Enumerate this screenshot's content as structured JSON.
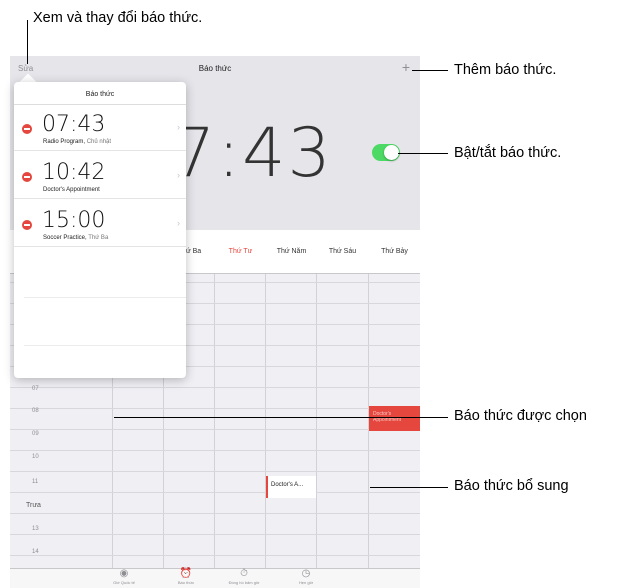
{
  "callouts": {
    "view_edit": "Xem và thay đổi báo thức.",
    "add": "Thêm báo thức.",
    "toggle": "Bật/tắt báo thức.",
    "selected": "Báo thức được chọn",
    "additional": "Báo thức bổ sung"
  },
  "navbar": {
    "edit_label": "Sửa",
    "title": "Báo thức",
    "add_symbol": "+"
  },
  "main": {
    "big_time": "7:43",
    "toggle_on": true,
    "accent_color": "#e5463d",
    "toggle_color": "#4cd964"
  },
  "week": {
    "days": [
      "Thứ Ba",
      "Thứ Tư",
      "Thứ Năm",
      "Thứ Sáu",
      "Thứ Bảy"
    ],
    "today_index": 1,
    "hours": [
      "07",
      "08",
      "09",
      "10",
      "11",
      "Trưa",
      "13",
      "14"
    ]
  },
  "popover": {
    "title": "Báo thức",
    "alarms": [
      {
        "time": "07:43",
        "label": "Radio Program",
        "repeat": "Chủ nhật"
      },
      {
        "time": "10:42",
        "label": "Doctor's Appointment",
        "repeat": ""
      },
      {
        "time": "15:00",
        "label": "Soccer Practice",
        "repeat": "Thứ Ba"
      }
    ]
  },
  "grid_events": {
    "extra_label": "Doctor's A..."
  },
  "tabbar": {
    "tabs": [
      {
        "icon": "globe-icon",
        "label": "Giờ Quốc tế"
      },
      {
        "icon": "alarm-clock-icon",
        "label": "Báo thức"
      },
      {
        "icon": "stopwatch-icon",
        "label": "Đồng hồ bấm giờ"
      },
      {
        "icon": "timer-icon",
        "label": "Hẹn giờ"
      }
    ]
  }
}
